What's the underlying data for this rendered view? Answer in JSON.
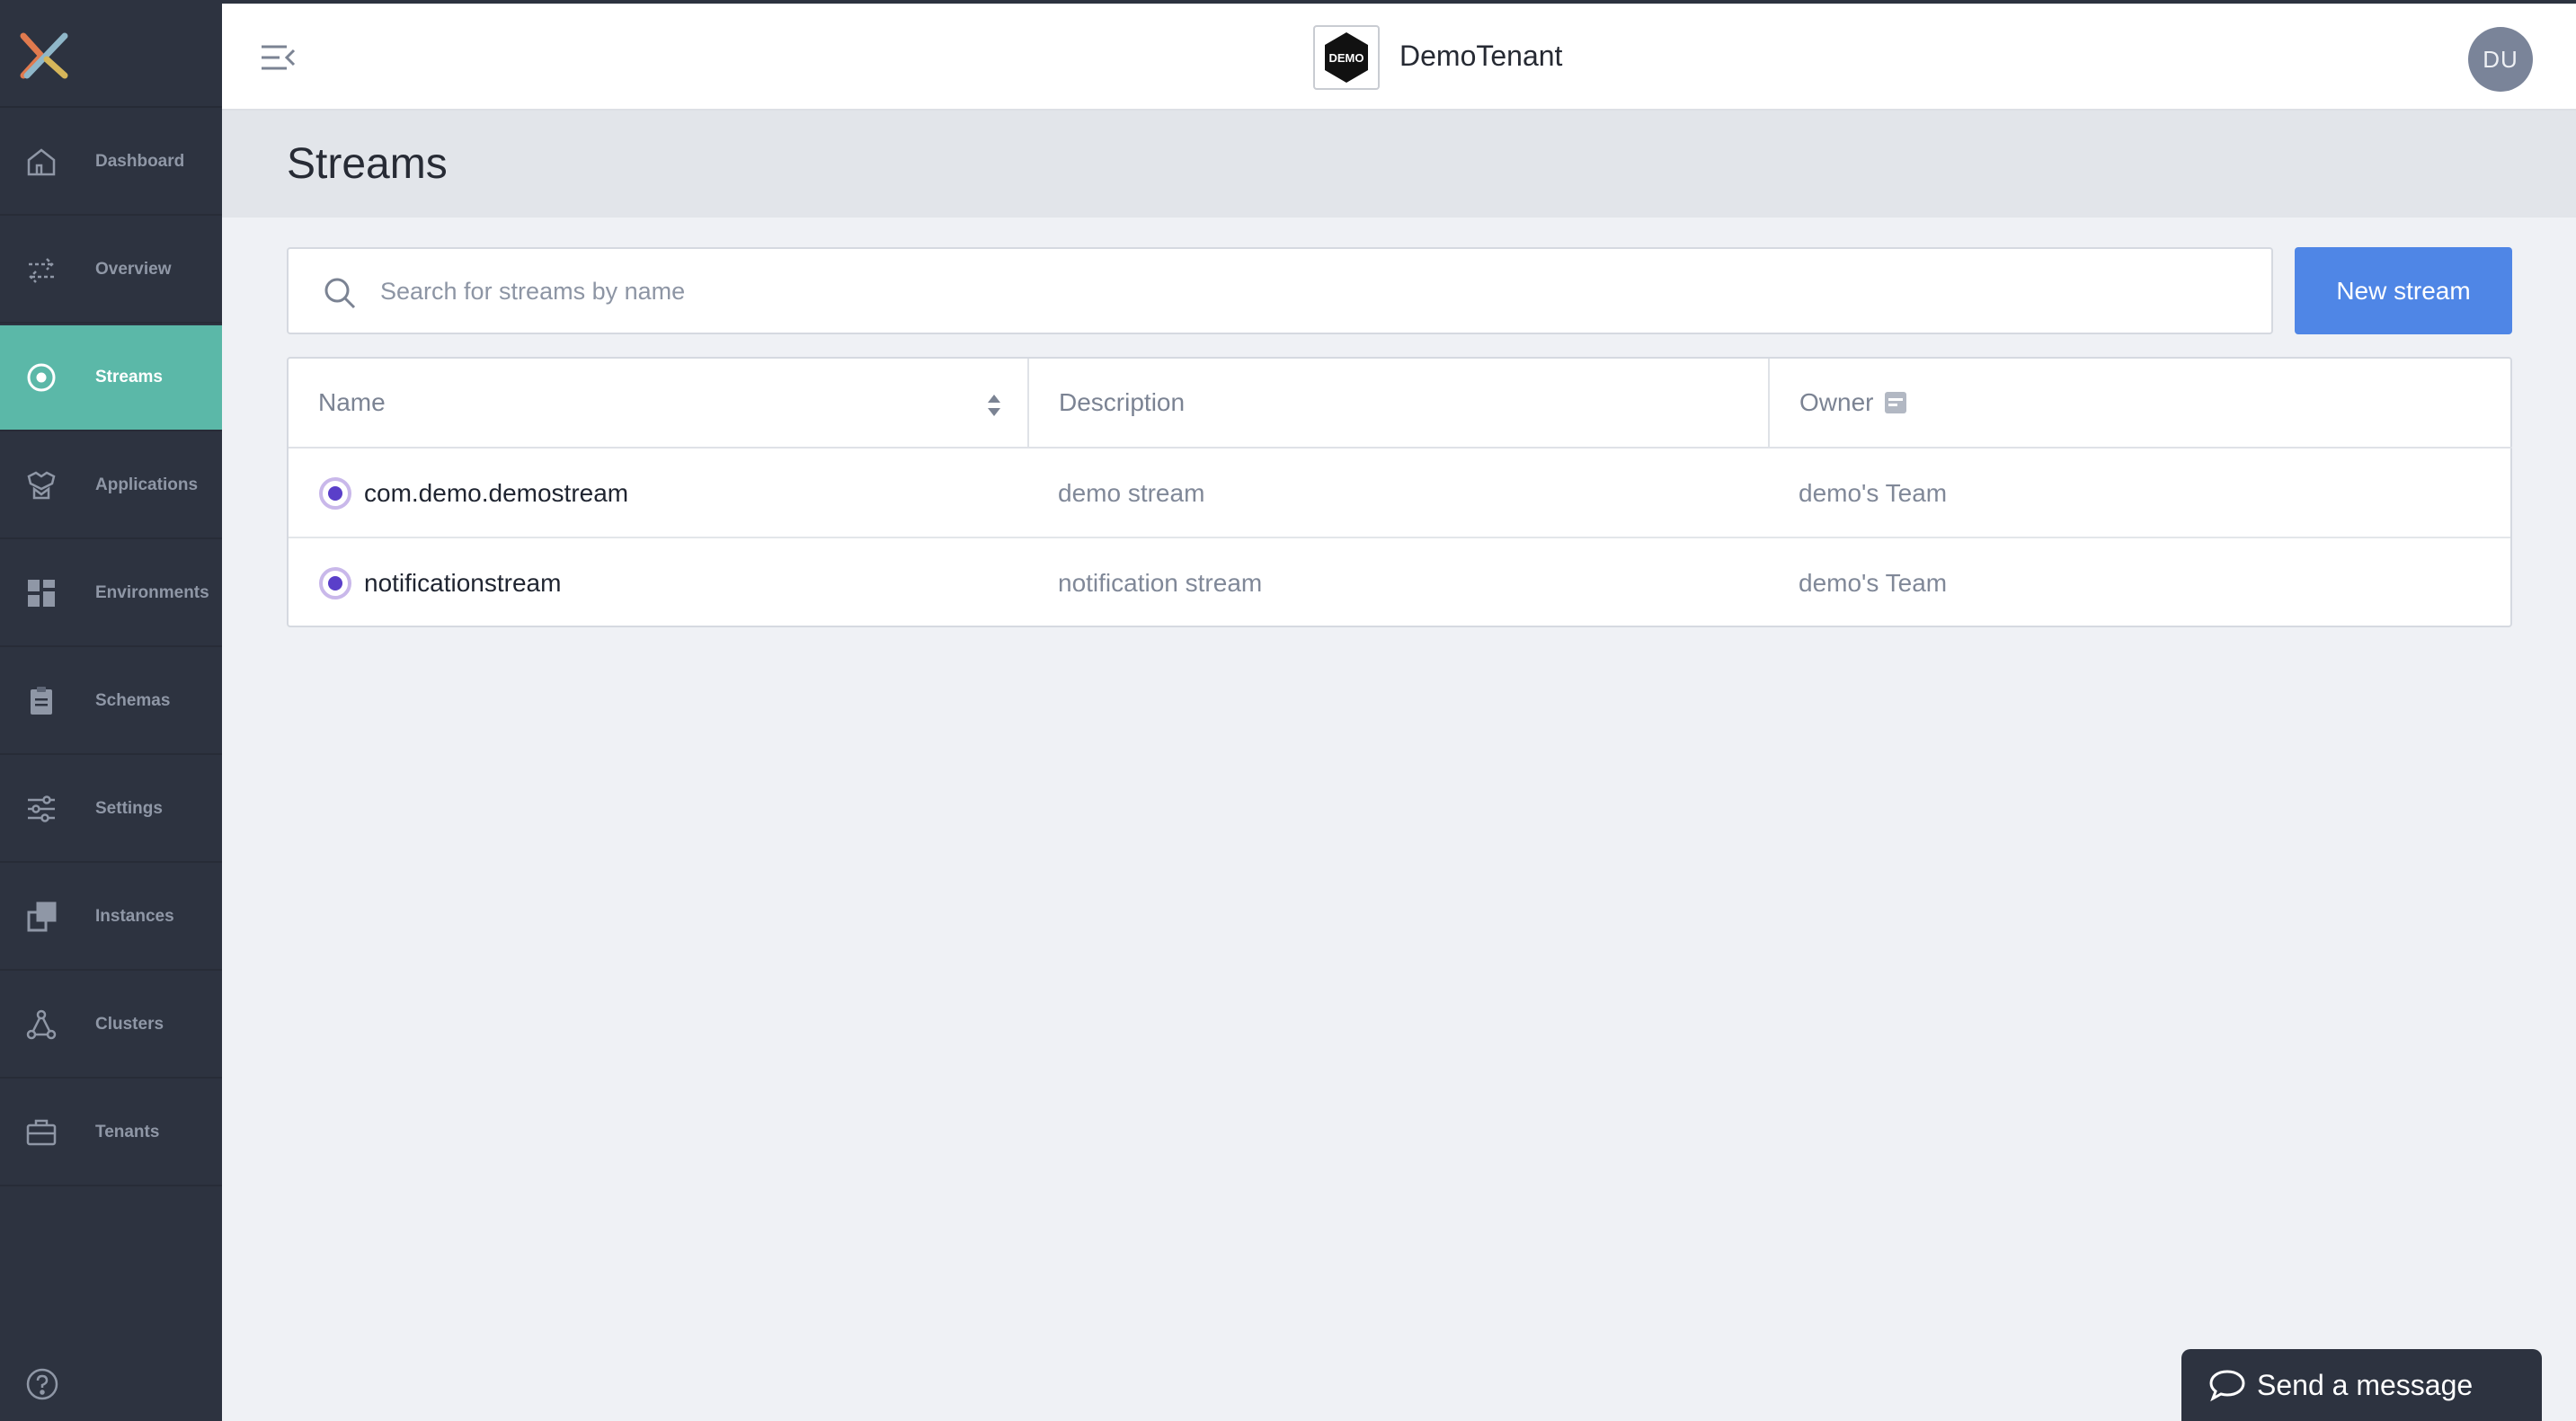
{
  "app": {
    "tenant_name": "DemoTenant",
    "tenant_logo_text": "DEMO",
    "user_initials": "DU"
  },
  "sidebar": {
    "items": [
      {
        "label": "Dashboard",
        "icon": "home-icon",
        "active": false
      },
      {
        "label": "Overview",
        "icon": "arrows-icon",
        "active": false
      },
      {
        "label": "Streams",
        "icon": "target-icon",
        "active": true
      },
      {
        "label": "Applications",
        "icon": "applications-icon",
        "active": false
      },
      {
        "label": "Environments",
        "icon": "grid-icon",
        "active": false
      },
      {
        "label": "Schemas",
        "icon": "clipboard-icon",
        "active": false
      },
      {
        "label": "Settings",
        "icon": "sliders-icon",
        "active": false
      },
      {
        "label": "Instances",
        "icon": "instances-icon",
        "active": false
      },
      {
        "label": "Clusters",
        "icon": "cluster-icon",
        "active": false
      },
      {
        "label": "Tenants",
        "icon": "briefcase-icon",
        "active": false
      }
    ]
  },
  "page": {
    "title": "Streams"
  },
  "search": {
    "placeholder": "Search for streams by name",
    "value": ""
  },
  "toolbar": {
    "new_stream_label": "New stream"
  },
  "table": {
    "columns": [
      "Name",
      "Description",
      "Owner"
    ],
    "rows": [
      {
        "name": "com.demo.demostream",
        "description": "demo stream",
        "owner": "demo's Team"
      },
      {
        "name": "notificationstream",
        "description": "notification stream",
        "owner": "demo's Team"
      }
    ]
  },
  "chat": {
    "label": "Send a message"
  },
  "colors": {
    "sidebar_bg": "#2d3340",
    "active_nav": "#5bb8a8",
    "primary_button": "#4f86e6",
    "stream_dot": "#5a3fc9"
  }
}
